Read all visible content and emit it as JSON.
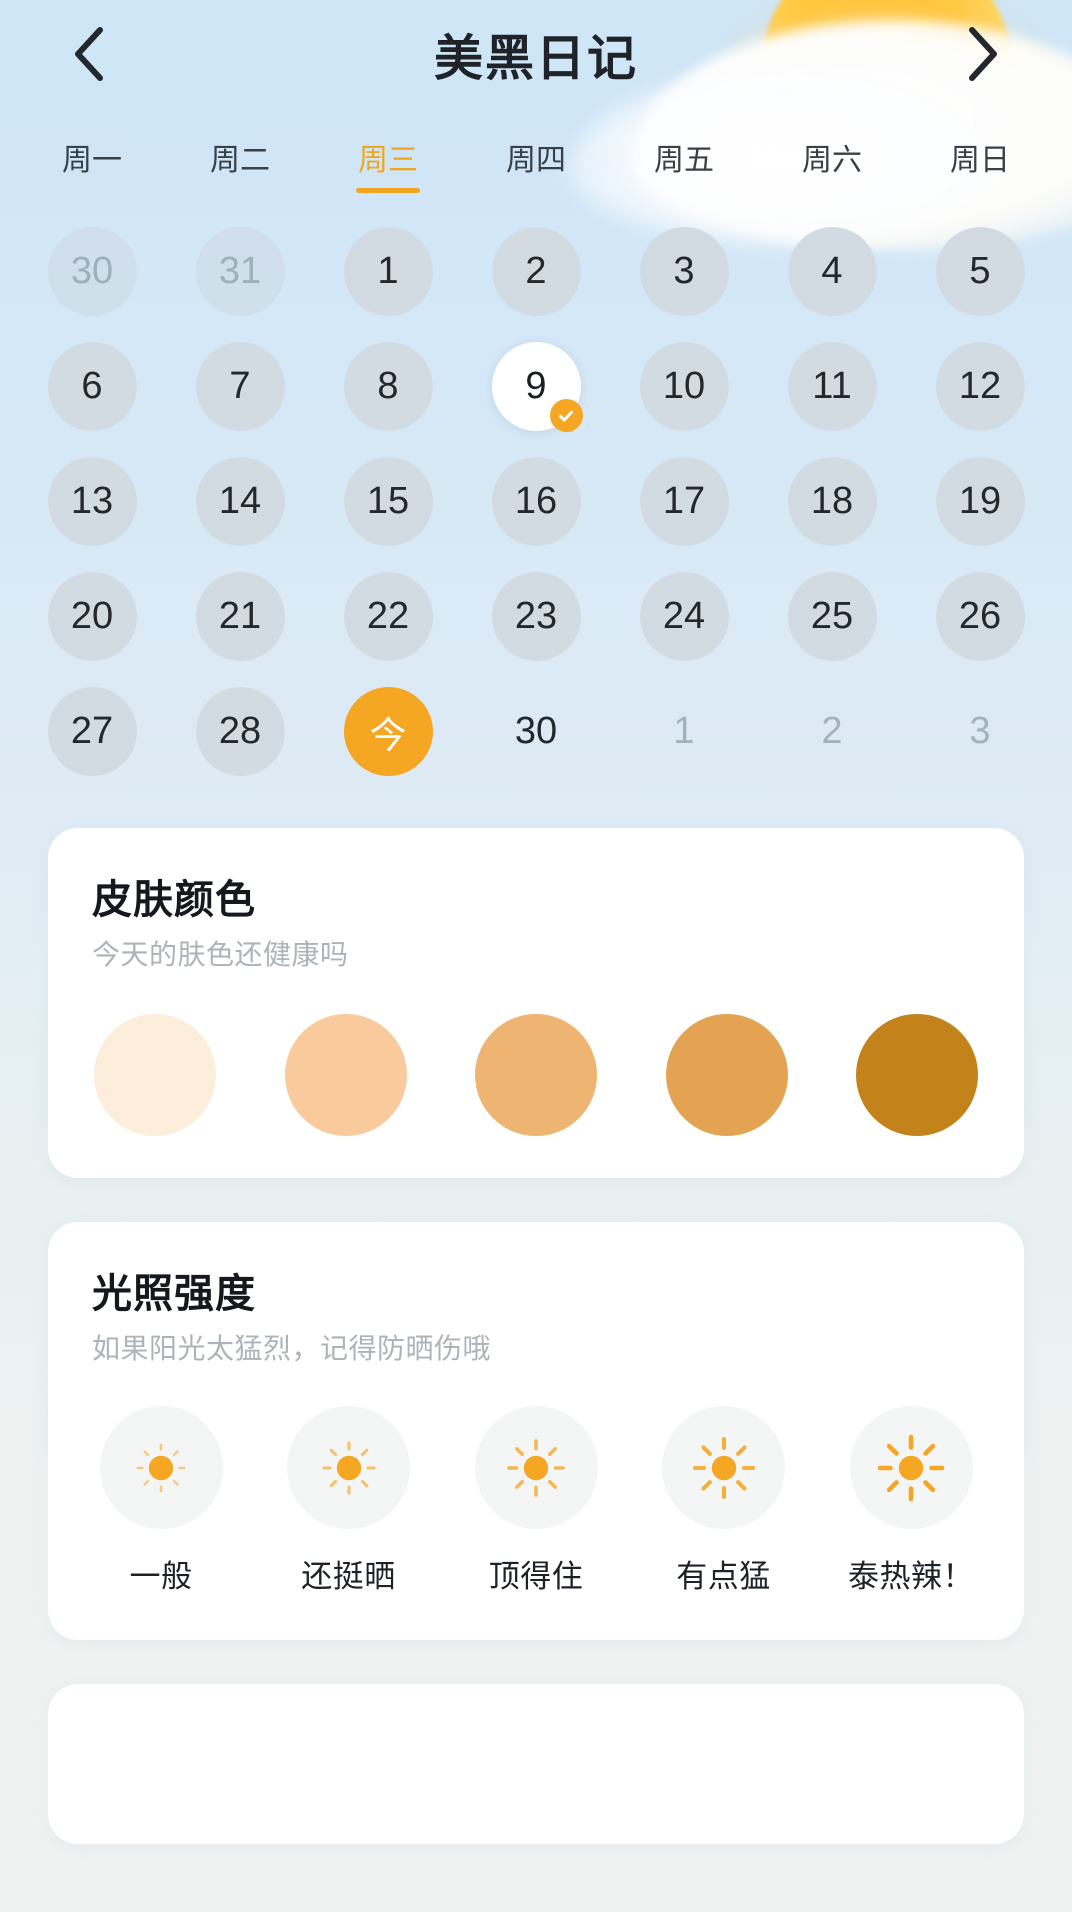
{
  "header": {
    "title": "美黑日记",
    "back_icon": "chevron-left-icon",
    "forward_icon": "chevron-right-icon"
  },
  "weekdays": [
    {
      "label": "周一",
      "active": false
    },
    {
      "label": "周二",
      "active": false
    },
    {
      "label": "周三",
      "active": true
    },
    {
      "label": "周四",
      "active": false
    },
    {
      "label": "周五",
      "active": false
    },
    {
      "label": "周六",
      "active": false
    },
    {
      "label": "周日",
      "active": false
    }
  ],
  "calendar": {
    "days": [
      {
        "label": "30",
        "state": "muted"
      },
      {
        "label": "31",
        "state": "muted"
      },
      {
        "label": "1",
        "state": "normal"
      },
      {
        "label": "2",
        "state": "normal"
      },
      {
        "label": "3",
        "state": "normal"
      },
      {
        "label": "4",
        "state": "normal"
      },
      {
        "label": "5",
        "state": "normal"
      },
      {
        "label": "6",
        "state": "normal"
      },
      {
        "label": "7",
        "state": "normal"
      },
      {
        "label": "8",
        "state": "normal"
      },
      {
        "label": "9",
        "state": "selected",
        "badge": "check-icon"
      },
      {
        "label": "10",
        "state": "normal"
      },
      {
        "label": "11",
        "state": "normal"
      },
      {
        "label": "12",
        "state": "normal"
      },
      {
        "label": "13",
        "state": "normal"
      },
      {
        "label": "14",
        "state": "normal"
      },
      {
        "label": "15",
        "state": "normal"
      },
      {
        "label": "16",
        "state": "normal"
      },
      {
        "label": "17",
        "state": "normal"
      },
      {
        "label": "18",
        "state": "normal"
      },
      {
        "label": "19",
        "state": "normal"
      },
      {
        "label": "20",
        "state": "normal"
      },
      {
        "label": "21",
        "state": "normal"
      },
      {
        "label": "22",
        "state": "normal"
      },
      {
        "label": "23",
        "state": "normal"
      },
      {
        "label": "24",
        "state": "normal"
      },
      {
        "label": "25",
        "state": "normal"
      },
      {
        "label": "26",
        "state": "normal"
      },
      {
        "label": "27",
        "state": "normal"
      },
      {
        "label": "28",
        "state": "normal"
      },
      {
        "label": "今",
        "state": "today"
      },
      {
        "label": "30",
        "state": "plain"
      },
      {
        "label": "1",
        "state": "plain-muted"
      },
      {
        "label": "2",
        "state": "plain-muted"
      },
      {
        "label": "3",
        "state": "plain-muted"
      }
    ]
  },
  "skin_card": {
    "title": "皮肤颜色",
    "subtitle": "今天的肤色还健康吗",
    "swatches": [
      {
        "name": "tone-1",
        "color": "#fdeedb"
      },
      {
        "name": "tone-2",
        "color": "#f9cb9c"
      },
      {
        "name": "tone-3",
        "color": "#eeb471"
      },
      {
        "name": "tone-4",
        "color": "#e3a353"
      },
      {
        "name": "tone-5",
        "color": "#c4821a"
      }
    ]
  },
  "light_card": {
    "title": "光照强度",
    "subtitle": "如果阳光太猛烈，记得防晒伤哦",
    "accent": "#f5a623",
    "options": [
      {
        "label": "一般",
        "level": 1,
        "icon": "sun-icon"
      },
      {
        "label": "还挺晒",
        "level": 2,
        "icon": "sun-icon"
      },
      {
        "label": "顶得住",
        "level": 3,
        "icon": "sun-icon"
      },
      {
        "label": "有点猛",
        "level": 4,
        "icon": "sun-icon"
      },
      {
        "label": "泰热辣！",
        "level": 5,
        "icon": "sun-icon"
      }
    ]
  },
  "theme": {
    "accent": "#f5a623",
    "sky_top": "#cfe6f7",
    "page_bottom": "#eef2f1",
    "day_disc": "#d3dbe2",
    "muted_text": "#9fb0bd"
  }
}
